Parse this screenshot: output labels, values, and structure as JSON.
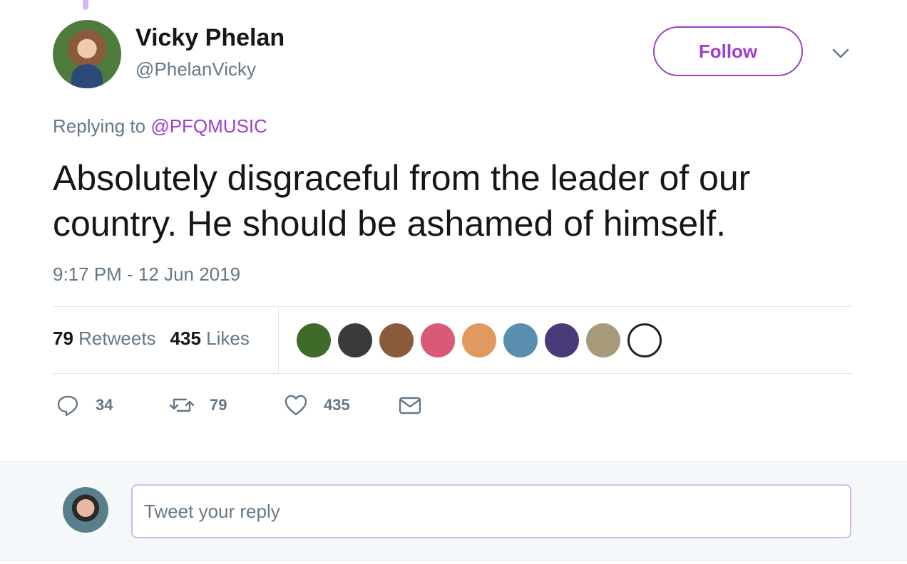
{
  "tweet": {
    "author": {
      "name": "Vicky Phelan",
      "handle": "@PhelanVicky"
    },
    "follow_label": "Follow",
    "replying_prefix": "Replying to",
    "replying_to": "@PFQMUSIC",
    "text": "Absolutely disgraceful from the leader of our country. He should be ashamed of himself.",
    "timestamp": "9:17 PM - 12 Jun 2019",
    "stats": {
      "retweets_count": "79",
      "retweets_label": "Retweets",
      "likes_count": "435",
      "likes_label": "Likes"
    },
    "likers": [
      {
        "color": "#3f6b2a"
      },
      {
        "color": "#3a3a3a"
      },
      {
        "color": "#8a5a3c"
      },
      {
        "color": "#d95a78"
      },
      {
        "color": "#e09a60"
      },
      {
        "color": "#5a8fb0"
      },
      {
        "color": "#4a3a7a"
      },
      {
        "color": "#a69a7a"
      },
      {
        "color": "#ffffff"
      }
    ],
    "actions": {
      "reply_count": "34",
      "retweet_count": "79",
      "like_count": "435"
    }
  },
  "reply_box": {
    "placeholder": "Tweet your reply"
  },
  "colors": {
    "accent": "#9b3fd0",
    "muted": "#657786",
    "text": "#14171a"
  }
}
